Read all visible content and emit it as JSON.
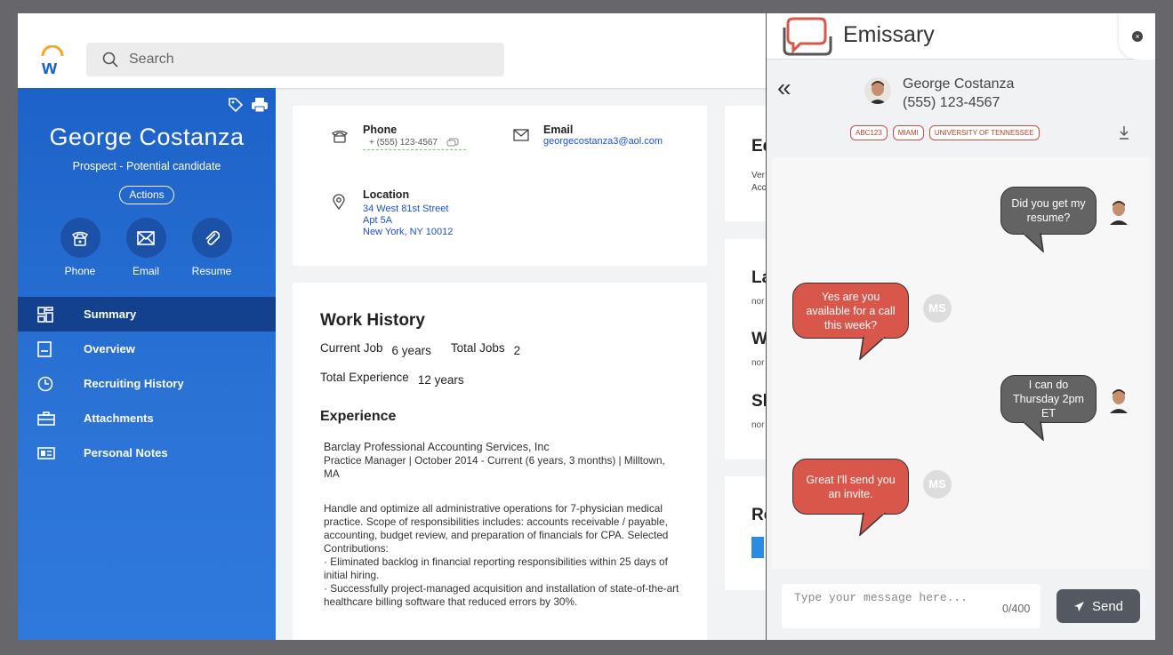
{
  "header": {
    "search_placeholder": "Search",
    "logo_letter": "w"
  },
  "profile": {
    "name": "George Costanza",
    "subtitle": "Prospect - Potential candidate",
    "actions_label": "Actions",
    "quick_actions": [
      "Phone",
      "Email",
      "Resume"
    ]
  },
  "nav": {
    "items": [
      {
        "label": "Summary",
        "icon": "grid-icon",
        "active": true
      },
      {
        "label": "Overview",
        "icon": "document-icon",
        "active": false
      },
      {
        "label": "Recruiting History",
        "icon": "clock-icon",
        "active": false
      },
      {
        "label": "Attachments",
        "icon": "briefcase-icon",
        "active": false
      },
      {
        "label": "Personal Notes",
        "icon": "id-card-icon",
        "active": false
      }
    ]
  },
  "contact": {
    "phone_label": "Phone",
    "phone_value": "+ (555) 123-4567",
    "email_label": "Email",
    "email_value": "georgecostanza3@aol.com",
    "location_label": "Location",
    "location_line1": "34 West 81st Street",
    "location_line2": "Apt 5A",
    "location_line3": "New York, NY 10012"
  },
  "work": {
    "title": "Work History",
    "current_job_label": "Current Job",
    "current_job_value": "6 years",
    "total_jobs_label": "Total Jobs",
    "total_jobs_value": "2",
    "total_exp_label": "Total Experience",
    "total_exp_value": "12 years",
    "experience_title": "Experience",
    "company": "Barclay Professional Accounting Services, Inc",
    "role": "Practice Manager | October 2014 - Current (6 years, 3 months) | Milltown, MA",
    "description": "Handle and optimize all administrative operations for 7-physician medical practice. Scope of responsibilities includes: accounts receivable / payable, accounting, budget review, and preparation of financials for CPA. Selected Contributions:",
    "bullet1": "· Eliminated backlog in financial reporting responsibilities within 25 days of initial hiring.",
    "bullet2": "· Successfully project-managed acquisition and installation of state-of-the-art healthcare billing software that reduced errors by 30%."
  },
  "right_cards": {
    "c1_title": "Ed",
    "c1_l1": "Ver",
    "c1_l2": "Acc",
    "c2_title": "La",
    "c2_l1": "nor",
    "c3_title": "W",
    "c3_l1": "nor",
    "c4_title": "Sk",
    "c4_l1": "nor",
    "c5_title": "Re"
  },
  "emissary": {
    "title": "Emissary",
    "contact_name": "George Costanza",
    "contact_phone": "(555) 123-4567",
    "tags": [
      "ABC123",
      "MIAMI",
      "UNIVERSITY OF TENNESSEE"
    ],
    "messages": [
      {
        "from": "candidate",
        "text": "Did you get my resume?"
      },
      {
        "from": "recruiter",
        "initials": "MS",
        "text": "Yes are you available for a call this week?"
      },
      {
        "from": "candidate",
        "text": "I can do Thursday 2pm ET"
      },
      {
        "from": "recruiter",
        "initials": "MS",
        "text": "Great I'll send you an invite."
      }
    ],
    "input_placeholder": "Type your message here...",
    "counter": "0/400",
    "send_label": "Send"
  },
  "colors": {
    "sidebar": "#1c62c8",
    "nav_active": "#13418d",
    "link": "#1d4fd0",
    "bubble_out": "#636363",
    "bubble_in": "#d9564a",
    "send_button": "#535861"
  }
}
